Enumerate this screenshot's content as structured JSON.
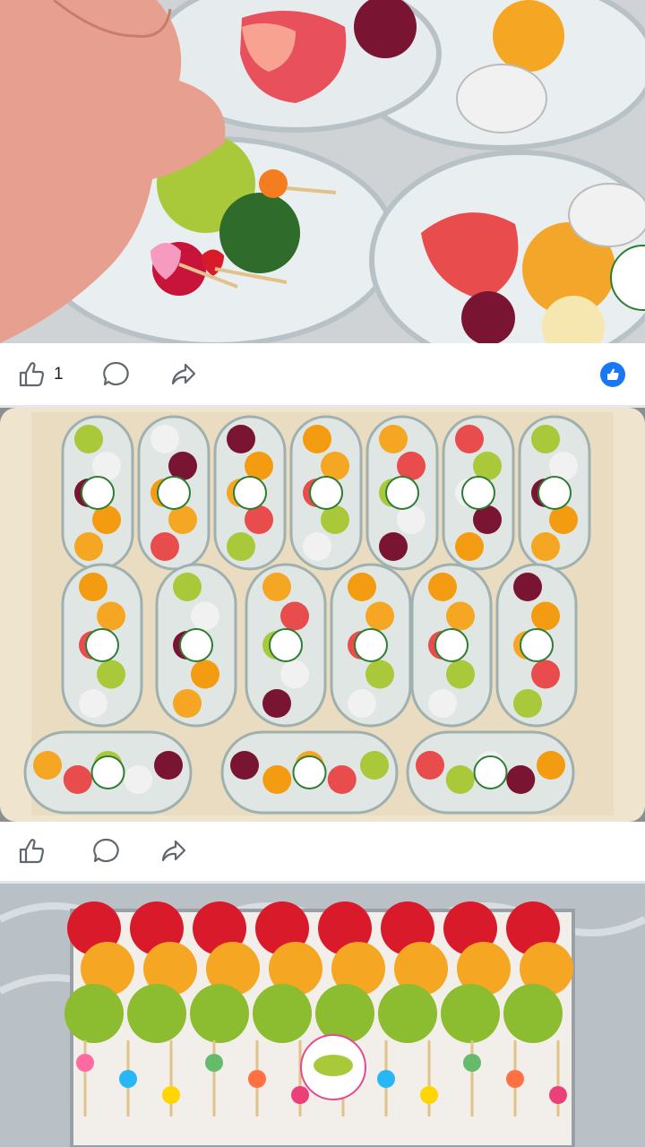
{
  "posts": [
    {
      "photo_description": "",
      "actions": {
        "like_count": "1"
      },
      "reaction_icon": "like-reaction-badge"
    },
    {
      "actions": {
        "like_count": ""
      }
    },
    {
      "actions": {}
    }
  ],
  "icons": {
    "like": "thumbs-up-icon",
    "comment": "comment-bubble-icon",
    "share": "share-arrow-icon"
  },
  "colors": {
    "feed_background": "#e4e6eb",
    "action_bar": "#ffffff",
    "icon_stroke": "#606770",
    "reaction_blue": "#1877f2"
  }
}
